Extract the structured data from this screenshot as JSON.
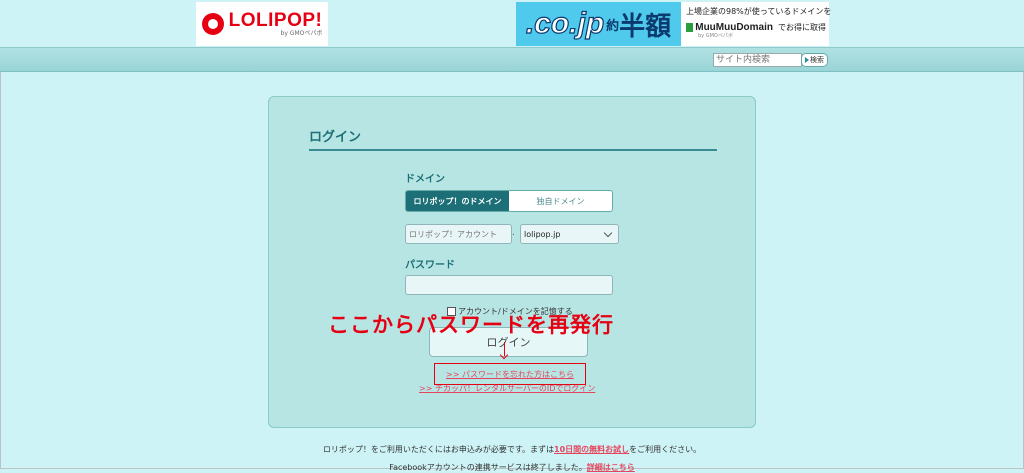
{
  "header": {
    "logo_text": "LOLIPOP!",
    "logo_sub": "by GMOペパボ",
    "banner": {
      "domain_text": ".co.jp",
      "small_text": "約",
      "big_text": "半額",
      "right_line1": "上場企業の98%が使っているドメインを",
      "brand": "MuuMuuDomain",
      "right_tail": "でお得に取得",
      "gmo": "by GMOペパボ"
    }
  },
  "nav": {
    "search_placeholder": "サイト内検索",
    "search_button": "検索"
  },
  "login": {
    "title": "ログイン",
    "domain_label": "ドメイン",
    "tab_lolipop": "ロリポップ！のドメイン",
    "tab_custom": "独自ドメイン",
    "account_placeholder": "ロリポップ！アカウント",
    "separator": ".",
    "domain_selected": "lolipop.jp",
    "password_label": "パスワード",
    "remember_label": "アカウント/ドメインを記憶する",
    "button": "ログイン",
    "forgot_link": ">> パスワードを忘れた方はこちら",
    "chikappa_link": ">> チカッパ！レンタルサーバーのIDでログイン"
  },
  "annotation": {
    "text": "ここからパスワードを再発行",
    "color": "#e60012"
  },
  "footer": {
    "line1_pre": "ロリポップ！をご利用いただくにはお申込みが必要です。まずは",
    "line1_link": "10日間の無料お試し",
    "line1_post": "をご利用ください。",
    "line2_pre": "Facebookアカウントの連携サービスは終了しました。",
    "line2_link": "詳細はこちら"
  },
  "colors": {
    "background": "#cdf3f6",
    "accent": "#1c6e77",
    "link": "#e5455c",
    "brand_red": "#e60012"
  }
}
